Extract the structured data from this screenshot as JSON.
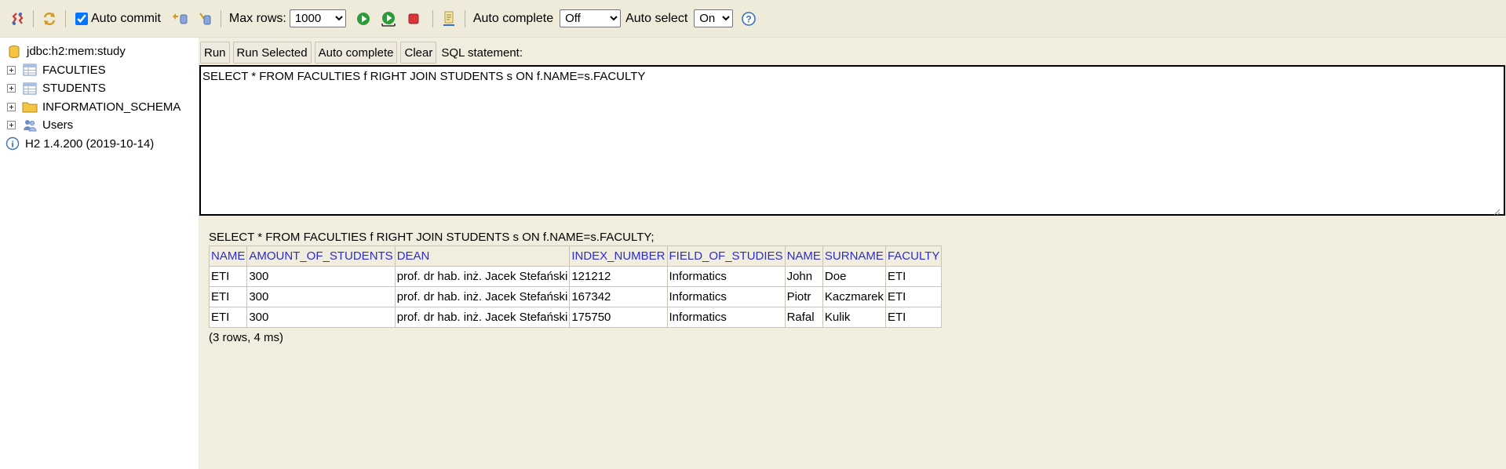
{
  "toolbar": {
    "auto_commit_label": "Auto commit",
    "auto_commit_checked": true,
    "max_rows_label": "Max rows:",
    "max_rows_value": "1000",
    "auto_complete_label": "Auto complete",
    "auto_complete_value": "Off",
    "auto_select_label": "Auto select",
    "auto_select_value": "On"
  },
  "sidebar": {
    "connection": "jdbc:h2:mem:study",
    "items": [
      {
        "label": "FACULTIES",
        "icon": "table-icon"
      },
      {
        "label": "STUDENTS",
        "icon": "table-icon"
      },
      {
        "label": "INFORMATION_SCHEMA",
        "icon": "folder-icon"
      },
      {
        "label": "Users",
        "icon": "users-icon"
      }
    ],
    "version": "H2 1.4.200 (2019-10-14)"
  },
  "editor": {
    "buttons": {
      "run": "Run",
      "run_selected": "Run Selected",
      "auto_complete": "Auto complete",
      "clear": "Clear"
    },
    "sql_label": "SQL statement:",
    "sql_text": "SELECT * FROM FACULTIES f RIGHT JOIN STUDENTS s ON f.NAME=s.FACULTY"
  },
  "result": {
    "query": "SELECT * FROM FACULTIES f RIGHT JOIN STUDENTS s ON f.NAME=s.FACULTY;",
    "columns": [
      "NAME",
      "AMOUNT_OF_STUDENTS",
      "DEAN",
      "INDEX_NUMBER",
      "FIELD_OF_STUDIES",
      "NAME",
      "SURNAME",
      "FACULTY"
    ],
    "rows": [
      [
        "ETI",
        "300",
        "prof. dr hab. inż. Jacek Stefański",
        "121212",
        "Informatics",
        "John",
        "Doe",
        "ETI"
      ],
      [
        "ETI",
        "300",
        "prof. dr hab. inż. Jacek Stefański",
        "167342",
        "Informatics",
        "Piotr",
        "Kaczmarek",
        "ETI"
      ],
      [
        "ETI",
        "300",
        "prof. dr hab. inż. Jacek Stefański",
        "175750",
        "Informatics",
        "Rafal",
        "Kulik",
        "ETI"
      ]
    ],
    "summary": "(3 rows, 4 ms)"
  }
}
